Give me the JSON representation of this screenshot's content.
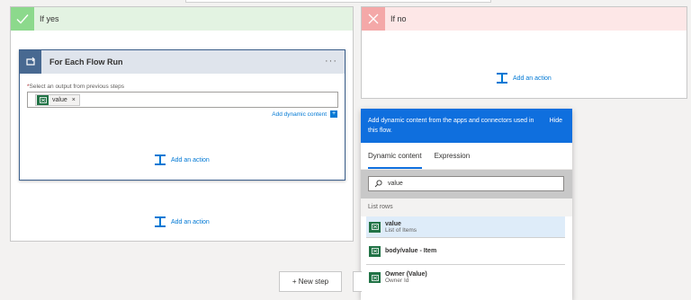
{
  "branch_yes": {
    "label": "If yes"
  },
  "branch_no": {
    "label": "If no",
    "add_action": "Add an action"
  },
  "foreach": {
    "title": "For Each Flow Run",
    "more": "···",
    "field_label_required": "*",
    "field_label": "Select an output from previous steps",
    "token": "value",
    "token_remove": "×",
    "dynamic_link": "Add dynamic content",
    "dynamic_plus": "+",
    "add_action": "Add an action"
  },
  "yes_add_action": "Add an action",
  "dynamic_panel": {
    "message": "Add dynamic content from the apps and connectors used in this flow.",
    "hide": "Hide",
    "tabs": [
      "Dynamic content",
      "Expression"
    ],
    "search_value": "value",
    "section": "List rows",
    "items": [
      {
        "title": "value",
        "subtitle": "List of Items"
      },
      {
        "title": "body/value - Item",
        "subtitle": ""
      },
      {
        "title": "Owner (Value)",
        "subtitle": "Owner Id"
      }
    ]
  },
  "new_step": "+ New step",
  "colors": {
    "accent": "#0f6fde",
    "excel_green": "#217346",
    "yes_header": "#e3f3e2",
    "no_header": "#fde7e7"
  }
}
